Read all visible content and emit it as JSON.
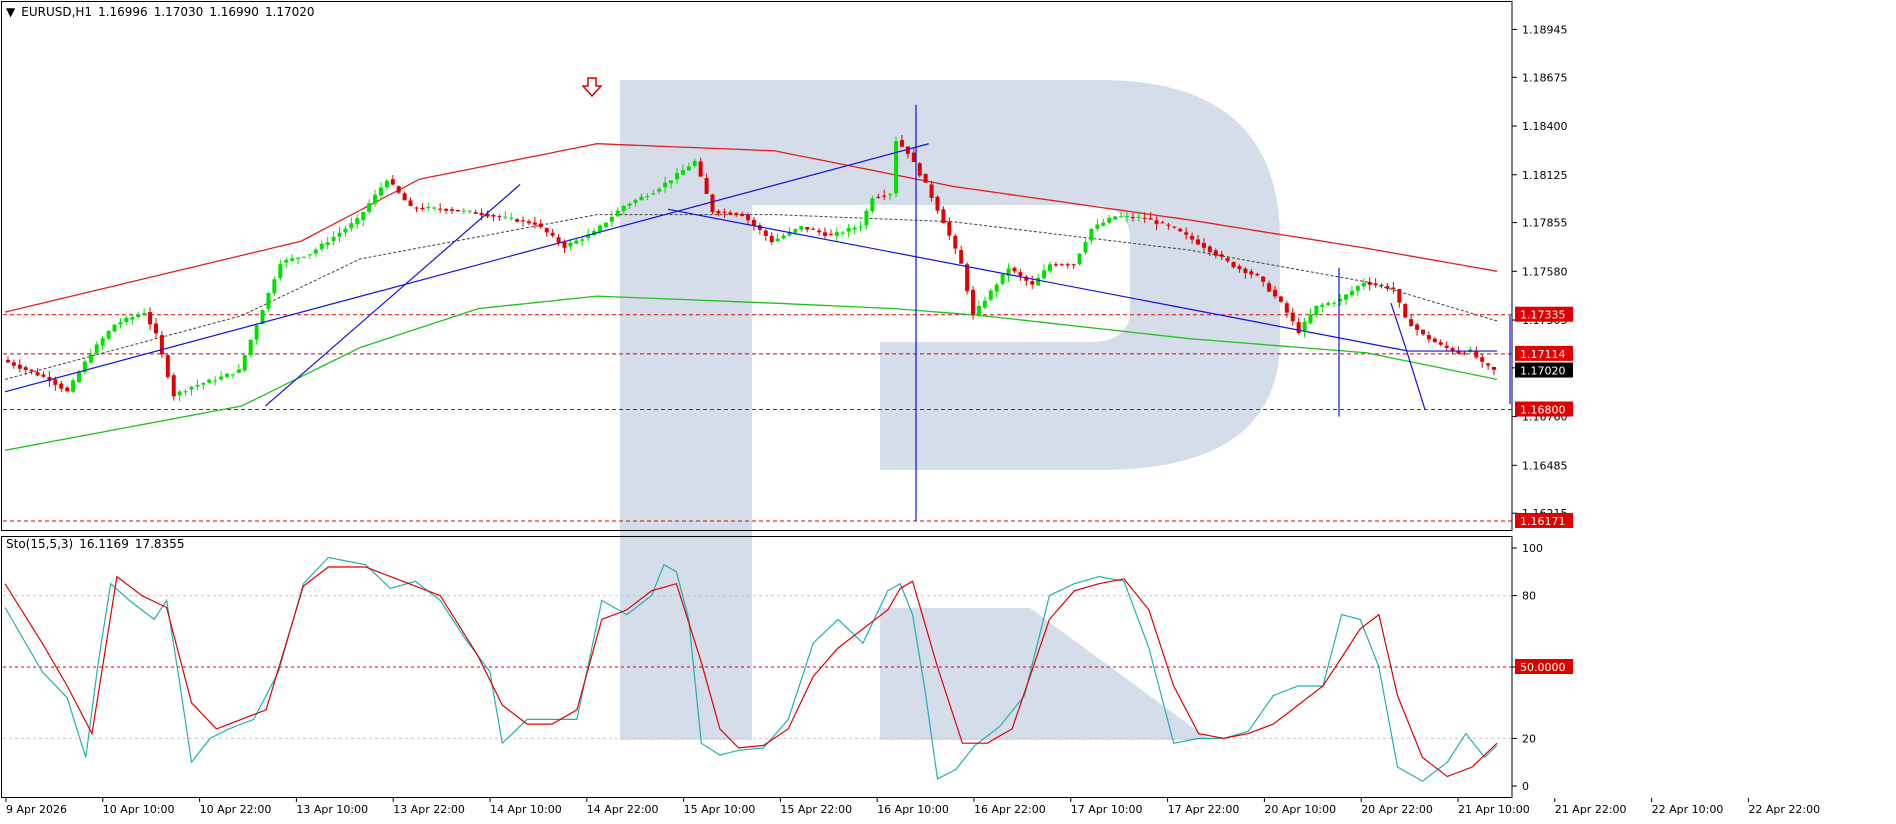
{
  "header": {
    "symbol": "EURUSD,H1",
    "open": "1.16996",
    "high": "1.17030",
    "low": "1.16990",
    "close": "1.17020"
  },
  "stochastic": {
    "label": "Sto(15,5,3)",
    "main_value": "16.1169",
    "signal_value": "17.8355"
  },
  "colors": {
    "bull": "#00e000",
    "bear": "#e00000",
    "upper_band": "#e02020",
    "lower_band": "#20c020",
    "ma": "#404040",
    "trend": "#1010e0",
    "level": "#e00000",
    "stoch_main": "#20b0b0",
    "stoch_signal": "#e00000",
    "watermark": "#d2dbe8"
  },
  "chart_data": [
    {
      "type": "candlestick",
      "title": "EURUSD,H1",
      "ylim": [
        1.1612,
        1.191
      ],
      "y_ticks": [
        "1.18945",
        "1.18675",
        "1.18400",
        "1.18125",
        "1.17855",
        "1.17580",
        "1.17305",
        "1.17035",
        "1.16760",
        "1.16485",
        "1.16215"
      ],
      "x_ticks": [
        "9 Apr 2026",
        "10 Apr 10:00",
        "10 Apr 22:00",
        "13 Apr 10:00",
        "13 Apr 22:00",
        "14 Apr 10:00",
        "14 Apr 22:00",
        "15 Apr 10:00",
        "15 Apr 22:00",
        "16 Apr 10:00",
        "16 Apr 22:00",
        "17 Apr 10:00",
        "17 Apr 22:00",
        "20 Apr 10:00",
        "20 Apr 22:00",
        "21 Apr 10:00",
        "21 Apr 22:00",
        "22 Apr 10:00",
        "22 Apr 22:00"
      ],
      "levels": [
        {
          "label": "1.17335",
          "value": 1.17335
        },
        {
          "label": "1.17114",
          "value": 1.17114
        },
        {
          "label": "1.16800",
          "value": 1.168
        },
        {
          "label": "1.16171",
          "value": 1.16171
        }
      ],
      "current_price": {
        "label": "1.17020",
        "value": 1.1702
      },
      "anchors": [
        [
          0,
          1.1708
        ],
        [
          8,
          1.1697
        ],
        [
          11,
          1.169
        ],
        [
          15,
          1.1712
        ],
        [
          19,
          1.1728
        ],
        [
          24,
          1.1735
        ],
        [
          26,
          1.1722
        ],
        [
          29,
          1.1688
        ],
        [
          32,
          1.1693
        ],
        [
          36,
          1.1697
        ],
        [
          40,
          1.1702
        ],
        [
          47,
          1.1763
        ],
        [
          52,
          1.1768
        ],
        [
          60,
          1.1787
        ],
        [
          65,
          1.181
        ],
        [
          69,
          1.1794
        ],
        [
          75,
          1.1793
        ],
        [
          80,
          1.1791
        ],
        [
          90,
          1.1785
        ],
        [
          95,
          1.1772
        ],
        [
          100,
          1.178
        ],
        [
          105,
          1.1795
        ],
        [
          110,
          1.1803
        ],
        [
          113,
          1.181
        ],
        [
          117,
          1.182
        ],
        [
          120,
          1.1792
        ],
        [
          125,
          1.179
        ],
        [
          130,
          1.1775
        ],
        [
          135,
          1.1783
        ],
        [
          140,
          1.1778
        ],
        [
          145,
          1.1784
        ],
        [
          147,
          1.18
        ],
        [
          150,
          1.1802
        ],
        [
          151,
          1.1832
        ],
        [
          153,
          1.1825
        ],
        [
          156,
          1.1807
        ],
        [
          159,
          1.1786
        ],
        [
          162,
          1.1762
        ],
        [
          164,
          1.1733
        ],
        [
          166,
          1.1742
        ],
        [
          170,
          1.176
        ],
        [
          174,
          1.175
        ],
        [
          177,
          1.1762
        ],
        [
          181,
          1.1762
        ],
        [
          184,
          1.1782
        ],
        [
          188,
          1.1789
        ],
        [
          193,
          1.1788
        ],
        [
          198,
          1.1782
        ],
        [
          203,
          1.1772
        ],
        [
          208,
          1.1761
        ],
        [
          212,
          1.1755
        ],
        [
          216,
          1.174
        ],
        [
          219,
          1.1724
        ],
        [
          222,
          1.1738
        ],
        [
          226,
          1.1742
        ],
        [
          230,
          1.1752
        ],
        [
          235,
          1.1748
        ],
        [
          237,
          1.1731
        ],
        [
          240,
          1.1722
        ],
        [
          243,
          1.1716
        ],
        [
          246,
          1.1712
        ],
        [
          248,
          1.1713
        ],
        [
          250,
          1.1706
        ],
        [
          252,
          1.1702
        ]
      ],
      "series": [
        {
          "name": "",
          "values": [
            [
              0,
              1.1735
            ],
            [
              50,
              1.1775
            ],
            [
              70,
              1.181
            ],
            [
              100,
              1.183
            ],
            [
              130,
              1.1826
            ],
            [
              160,
              1.1806
            ],
            [
              200,
              1.1787
            ],
            [
              230,
              1.1771
            ],
            [
              252,
              1.1758
            ]
          ]
        },
        {
          "name": "",
          "values": [
            [
              0,
              1.1657
            ],
            [
              40,
              1.1682
            ],
            [
              60,
              1.1715
            ],
            [
              80,
              1.1737
            ],
            [
              100,
              1.1744
            ],
            [
              130,
              1.174
            ],
            [
              150,
              1.1737
            ],
            [
              165,
              1.1733
            ],
            [
              200,
              1.172
            ],
            [
              230,
              1.1712
            ],
            [
              252,
              1.1697
            ]
          ]
        },
        {
          "name": "",
          "values": [
            [
              0,
              1.1697
            ],
            [
              40,
              1.1733
            ],
            [
              60,
              1.1765
            ],
            [
              100,
              1.179
            ],
            [
              130,
              1.179
            ],
            [
              160,
              1.1786
            ],
            [
              200,
              1.177
            ],
            [
              230,
              1.1752
            ],
            [
              252,
              1.173
            ]
          ]
        }
      ]
    },
    {
      "type": "line",
      "title": "Sto(15,5,3)",
      "ylim": [
        0,
        100
      ],
      "y_ticks": [
        "100",
        "80",
        "50.0000",
        "20",
        "0"
      ],
      "levels": [
        {
          "label": "80",
          "value": 80
        },
        {
          "label": "50.0000",
          "value": 50
        },
        {
          "label": "20",
          "value": 20
        }
      ],
      "series": [
        {
          "name": "",
          "values": [
            [
              0,
              75
            ],
            [
              6,
              48
            ],
            [
              10,
              37
            ],
            [
              13,
              12
            ],
            [
              15,
              52
            ],
            [
              17,
              85
            ],
            [
              20,
              78
            ],
            [
              24,
              70
            ],
            [
              26,
              78
            ],
            [
              28,
              45
            ],
            [
              30,
              10
            ],
            [
              33,
              20
            ],
            [
              36,
              24
            ],
            [
              40,
              28
            ],
            [
              44,
              48
            ],
            [
              48,
              85
            ],
            [
              52,
              96
            ],
            [
              58,
              93
            ],
            [
              62,
              83
            ],
            [
              66,
              86
            ],
            [
              70,
              78
            ],
            [
              74,
              62
            ],
            [
              78,
              48
            ],
            [
              80,
              18
            ],
            [
              84,
              28
            ],
            [
              88,
              28
            ],
            [
              92,
              28
            ],
            [
              96,
              78
            ],
            [
              100,
              72
            ],
            [
              104,
              80
            ],
            [
              106,
              93
            ],
            [
              108,
              90
            ],
            [
              110,
              70
            ],
            [
              112,
              18
            ],
            [
              115,
              13
            ],
            [
              118,
              15
            ],
            [
              122,
              16
            ],
            [
              126,
              28
            ],
            [
              130,
              60
            ],
            [
              134,
              70
            ],
            [
              138,
              60
            ],
            [
              142,
              82
            ],
            [
              144,
              85
            ],
            [
              146,
              72
            ],
            [
              148,
              40
            ],
            [
              150,
              3
            ],
            [
              153,
              7
            ],
            [
              156,
              17
            ],
            [
              160,
              25
            ],
            [
              164,
              38
            ],
            [
              168,
              80
            ],
            [
              172,
              85
            ],
            [
              176,
              88
            ],
            [
              180,
              86
            ],
            [
              184,
              58
            ],
            [
              188,
              18
            ],
            [
              192,
              20
            ],
            [
              196,
              20
            ],
            [
              200,
              23
            ],
            [
              204,
              38
            ],
            [
              208,
              42
            ],
            [
              212,
              42
            ],
            [
              215,
              72
            ],
            [
              218,
              70
            ],
            [
              221,
              50
            ],
            [
              224,
              8
            ],
            [
              228,
              2
            ],
            [
              232,
              10
            ],
            [
              235,
              22
            ],
            [
              238,
              12
            ],
            [
              240,
              17
            ]
          ]
        },
        {
          "name": "",
          "values": [
            [
              0,
              85
            ],
            [
              6,
              60
            ],
            [
              10,
              42
            ],
            [
              14,
              22
            ],
            [
              18,
              88
            ],
            [
              22,
              80
            ],
            [
              26,
              75
            ],
            [
              30,
              35
            ],
            [
              34,
              24
            ],
            [
              38,
              28
            ],
            [
              42,
              32
            ],
            [
              48,
              84
            ],
            [
              52,
              92
            ],
            [
              58,
              92
            ],
            [
              62,
              88
            ],
            [
              66,
              84
            ],
            [
              70,
              80
            ],
            [
              76,
              55
            ],
            [
              80,
              34
            ],
            [
              84,
              26
            ],
            [
              88,
              26
            ],
            [
              92,
              32
            ],
            [
              96,
              70
            ],
            [
              100,
              74
            ],
            [
              104,
              82
            ],
            [
              108,
              85
            ],
            [
              112,
              52
            ],
            [
              115,
              24
            ],
            [
              118,
              16
            ],
            [
              122,
              17
            ],
            [
              126,
              24
            ],
            [
              130,
              46
            ],
            [
              134,
              58
            ],
            [
              138,
              66
            ],
            [
              142,
              74
            ],
            [
              144,
              83
            ],
            [
              146,
              86
            ],
            [
              150,
              50
            ],
            [
              154,
              18
            ],
            [
              158,
              18
            ],
            [
              162,
              24
            ],
            [
              168,
              70
            ],
            [
              172,
              82
            ],
            [
              176,
              85
            ],
            [
              180,
              87
            ],
            [
              184,
              74
            ],
            [
              188,
              42
            ],
            [
              192,
              22
            ],
            [
              196,
              20
            ],
            [
              200,
              22
            ],
            [
              204,
              26
            ],
            [
              208,
              34
            ],
            [
              212,
              42
            ],
            [
              215,
              54
            ],
            [
              218,
              66
            ],
            [
              221,
              72
            ],
            [
              224,
              38
            ],
            [
              228,
              12
            ],
            [
              232,
              4
            ],
            [
              236,
              8
            ],
            [
              240,
              18
            ]
          ]
        }
      ]
    }
  ]
}
